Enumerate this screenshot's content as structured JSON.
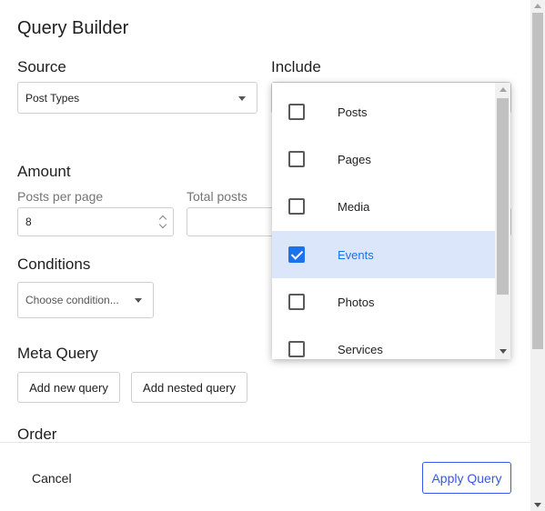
{
  "dialog": {
    "title": "Query Builder",
    "source": {
      "label": "Source",
      "value": "Post Types"
    },
    "include": {
      "label": "Include",
      "options": [
        {
          "label": "Posts",
          "checked": false
        },
        {
          "label": "Pages",
          "checked": false
        },
        {
          "label": "Media",
          "checked": false
        },
        {
          "label": "Events",
          "checked": true
        },
        {
          "label": "Photos",
          "checked": false
        },
        {
          "label": "Services",
          "checked": false
        }
      ]
    },
    "amount": {
      "label": "Amount",
      "posts_per_page_label": "Posts per page",
      "posts_per_page_value": "8",
      "total_posts_label": "Total posts",
      "total_posts_value": ""
    },
    "conditions": {
      "label": "Conditions",
      "placeholder": "Choose condition..."
    },
    "meta_query": {
      "label": "Meta Query",
      "add_new": "Add new query",
      "add_nested": "Add nested query"
    },
    "order": {
      "label": "Order"
    },
    "footer": {
      "cancel": "Cancel",
      "apply": "Apply Query"
    }
  },
  "colors": {
    "accent": "#3858e9",
    "checkbox_checked": "#1a73e8",
    "selected_row": "#dce6fb"
  }
}
